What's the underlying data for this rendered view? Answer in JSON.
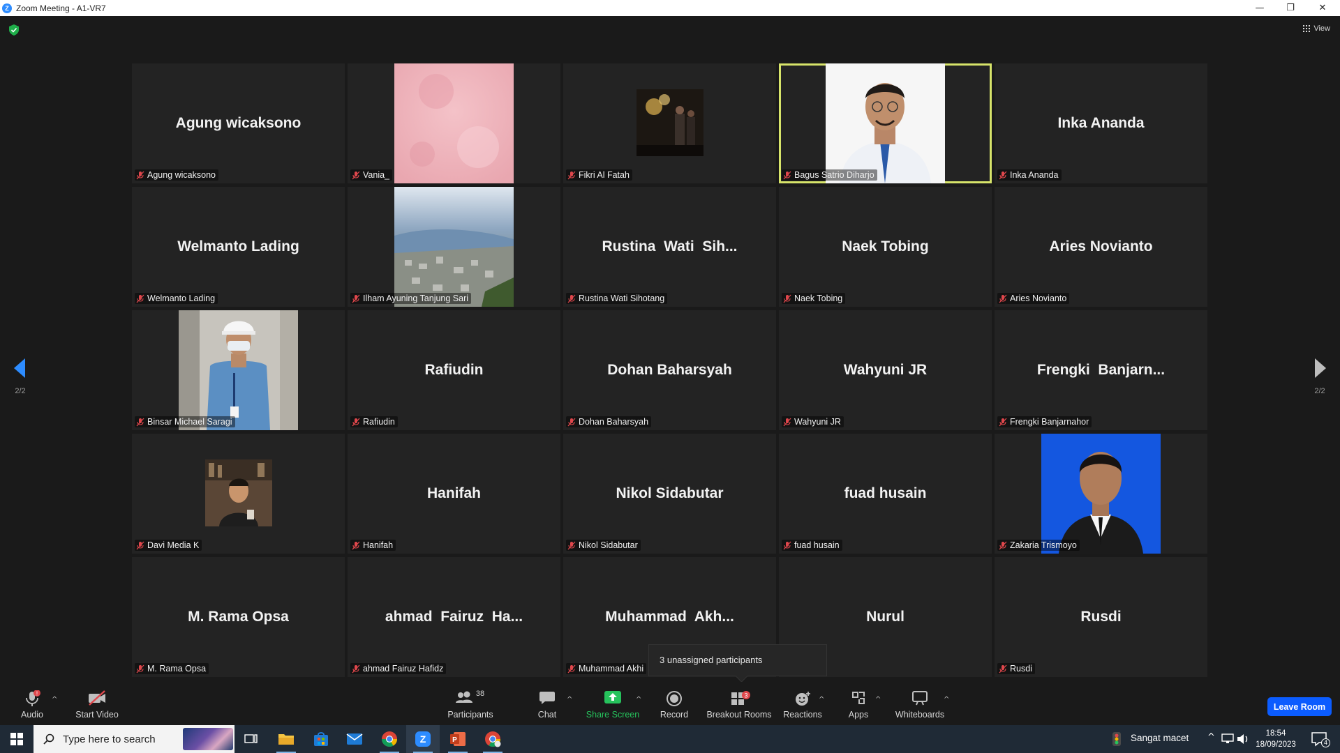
{
  "window": {
    "title": "Zoom Meeting - A1-VR7",
    "minimize": "—",
    "restore": "❐",
    "close": "✕"
  },
  "view_button": {
    "label": "View"
  },
  "pager": {
    "left": "2/2",
    "right": "2/2"
  },
  "participants_grid": [
    {
      "display": "Agung wicaksono",
      "tag": "Agung wicaksono",
      "photo": ""
    },
    {
      "display": "",
      "tag": "Vania_",
      "photo": "pink-texture"
    },
    {
      "display": "",
      "tag": "Fikri Al Fatah",
      "photo": "dark-event"
    },
    {
      "display": "",
      "tag": "Bagus Satrio Diharjo",
      "photo": "man-white-shirt",
      "active": true
    },
    {
      "display": "Inka Ananda",
      "tag": "Inka Ananda",
      "photo": ""
    },
    {
      "display": "Welmanto Lading",
      "tag": "Welmanto Lading",
      "photo": ""
    },
    {
      "display": "",
      "tag": "Ilham Ayuning Tanjung Sari",
      "photo": "aerial-city"
    },
    {
      "display": "Rustina  Wati  Sih...",
      "tag": "Rustina Wati Sihotang",
      "photo": ""
    },
    {
      "display": "Naek Tobing",
      "tag": "Naek Tobing",
      "photo": ""
    },
    {
      "display": "Aries Novianto",
      "tag": "Aries Novianto",
      "photo": ""
    },
    {
      "display": "",
      "tag": "Binsar Michael Saragi",
      "photo": "worker-helmet"
    },
    {
      "display": "Rafiudin",
      "tag": "Rafiudin",
      "photo": ""
    },
    {
      "display": "Dohan Baharsyah",
      "tag": "Dohan Baharsyah",
      "photo": ""
    },
    {
      "display": "Wahyuni JR",
      "tag": "Wahyuni JR",
      "photo": ""
    },
    {
      "display": "Frengki  Banjarn...",
      "tag": "Frengki Banjarnahor",
      "photo": ""
    },
    {
      "display": "",
      "tag": "Davi Media K",
      "photo": "man-cafe"
    },
    {
      "display": "Hanifah",
      "tag": "Hanifah",
      "photo": ""
    },
    {
      "display": "Nikol Sidabutar",
      "tag": "Nikol Sidabutar",
      "photo": ""
    },
    {
      "display": "fuad husain",
      "tag": "fuad husain",
      "photo": ""
    },
    {
      "display": "",
      "tag": "Zakaria Trismoyo",
      "photo": "blue-portrait"
    },
    {
      "display": "M. Rama Opsa",
      "tag": "M. Rama Opsa",
      "photo": ""
    },
    {
      "display": "ahmad  Fairuz  Ha...",
      "tag": "ahmad Fairuz Hafidz",
      "photo": ""
    },
    {
      "display": "Muhammad  Akh...",
      "tag": "Muhammad Akhi",
      "photo": ""
    },
    {
      "display": "Nurul",
      "tag": "",
      "photo": ""
    },
    {
      "display": "Rusdi",
      "tag": "Rusdi",
      "photo": ""
    }
  ],
  "popup": {
    "text": "3 unassigned participants"
  },
  "toolbar": {
    "audio": "Audio",
    "audio_alert": "!",
    "start_video": "Start Video",
    "participants": "Participants",
    "participants_count": "38",
    "chat": "Chat",
    "share_screen": "Share Screen",
    "record": "Record",
    "breakout_rooms": "Breakout Rooms",
    "breakout_count": "3",
    "reactions": "Reactions",
    "apps": "Apps",
    "whiteboards": "Whiteboards",
    "leave_room": "Leave Room"
  },
  "taskbar": {
    "search_placeholder": "Type here to search",
    "weather": "Sangat macet",
    "time": "18:54",
    "date": "18/09/2023",
    "notifications": "4"
  },
  "colors": {
    "active_speaker": "#d7e46a",
    "leave": "#0b5cff",
    "share_green": "#26c25c",
    "mute_red": "#e0474c"
  }
}
